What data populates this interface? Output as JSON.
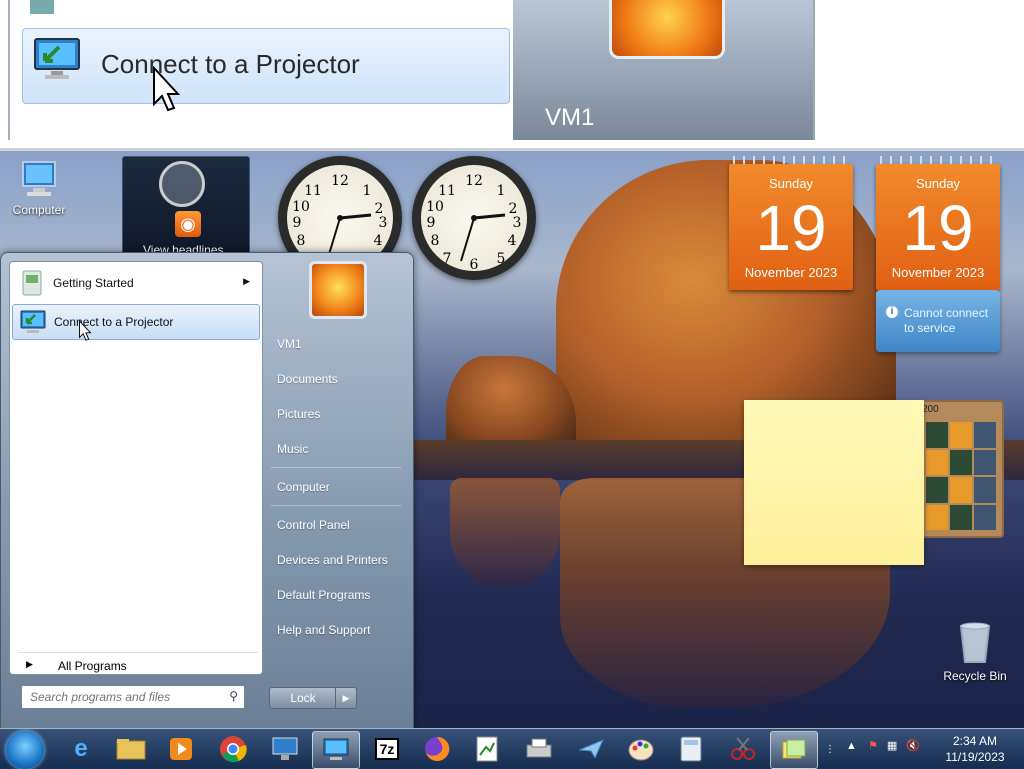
{
  "zoom": {
    "item_label": "Connect to a Projector",
    "user_label": "VM1"
  },
  "desktop": {
    "computer_label": "Computer",
    "recycle_label": "Recycle Bin",
    "rss_label": "View headlines",
    "puzzle_label": "200"
  },
  "calendars": [
    {
      "day": "Sunday",
      "date": "19",
      "month_year": "November 2023"
    },
    {
      "day": "Sunday",
      "date": "19",
      "month_year": "November 2023"
    }
  ],
  "notice": {
    "text": "Cannot connect to service"
  },
  "start_menu": {
    "items": [
      {
        "label": "Getting Started"
      },
      {
        "label": "Connect to a Projector"
      }
    ],
    "all_programs": "All Programs",
    "search_placeholder": "Search programs and files",
    "right_links": [
      "VM1",
      "Documents",
      "Pictures",
      "Music",
      "Computer",
      "Control Panel",
      "Devices and Printers",
      "Default Programs",
      "Help and Support"
    ],
    "lock_label": "Lock"
  },
  "taskbar": {
    "time": "2:34 AM",
    "date": "11/19/2023",
    "sevenzip_label": "7z"
  },
  "colors": {
    "accent": "#e06013",
    "selection": "#c8ddf5",
    "taskbar": "#143050"
  }
}
